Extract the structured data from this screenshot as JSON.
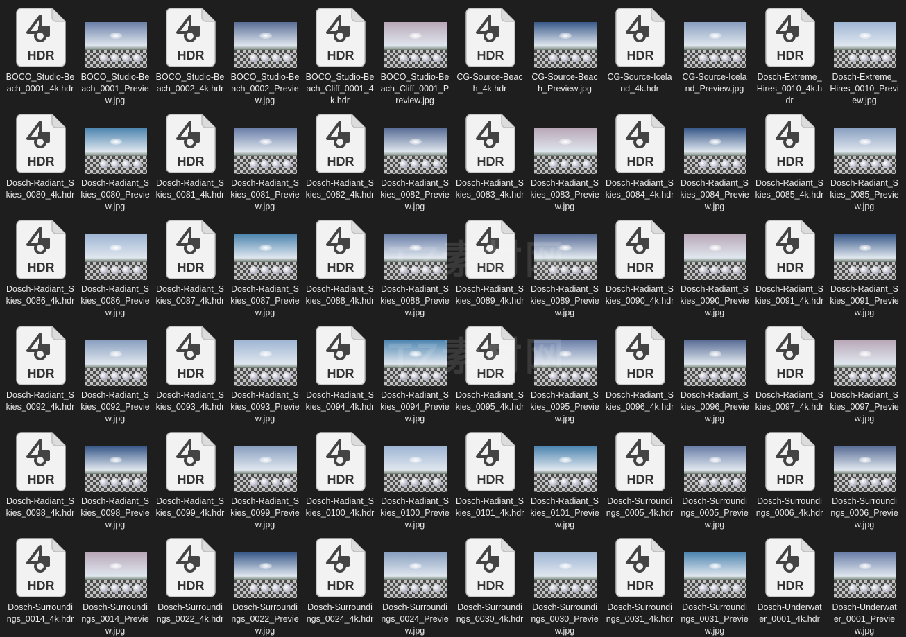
{
  "watermark": "TZ素材网",
  "icon_label": "HDR",
  "files": [
    "BOCO_Studio-Beach_0001_4k.hdr",
    "BOCO_Studio-Beach_0001_Preview.jpg",
    "BOCO_Studio-Beach_0002_4k.hdr",
    "BOCO_Studio-Beach_0002_Preview.jpg",
    "BOCO_Studio-Beach_Cliff_0001_4k.hdr",
    "BOCO_Studio-Beach_Cliff_0001_Preview.jpg",
    "CG-Source-Beach_4k.hdr",
    "CG-Source-Beach_Preview.jpg",
    "CG-Source-Iceland_4k.hdr",
    "CG-Source-Iceland_Preview.jpg",
    "Dosch-Extreme_Hires_0010_4k.hdr",
    "Dosch-Extreme_Hires_0010_Preview.jpg",
    "Dosch-Radiant_Skies_0080_4k.hdr",
    "Dosch-Radiant_Skies_0080_Preview.jpg",
    "Dosch-Radiant_Skies_0081_4k.hdr",
    "Dosch-Radiant_Skies_0081_Preview.jpg",
    "Dosch-Radiant_Skies_0082_4k.hdr",
    "Dosch-Radiant_Skies_0082_Preview.jpg",
    "Dosch-Radiant_Skies_0083_4k.hdr",
    "Dosch-Radiant_Skies_0083_Preview.jpg",
    "Dosch-Radiant_Skies_0084_4k.hdr",
    "Dosch-Radiant_Skies_0084_Preview.jpg",
    "Dosch-Radiant_Skies_0085_4k.hdr",
    "Dosch-Radiant_Skies_0085_Preview.jpg",
    "Dosch-Radiant_Skies_0086_4k.hdr",
    "Dosch-Radiant_Skies_0086_Preview.jpg",
    "Dosch-Radiant_Skies_0087_4k.hdr",
    "Dosch-Radiant_Skies_0087_Preview.jpg",
    "Dosch-Radiant_Skies_0088_4k.hdr",
    "Dosch-Radiant_Skies_0088_Preview.jpg",
    "Dosch-Radiant_Skies_0089_4k.hdr",
    "Dosch-Radiant_Skies_0089_Preview.jpg",
    "Dosch-Radiant_Skies_0090_4k.hdr",
    "Dosch-Radiant_Skies_0090_Preview.jpg",
    "Dosch-Radiant_Skies_0091_4k.hdr",
    "Dosch-Radiant_Skies_0091_Preview.jpg",
    "Dosch-Radiant_Skies_0092_4k.hdr",
    "Dosch-Radiant_Skies_0092_Preview.jpg",
    "Dosch-Radiant_Skies_0093_4k.hdr",
    "Dosch-Radiant_Skies_0093_Preview.jpg",
    "Dosch-Radiant_Skies_0094_4k.hdr",
    "Dosch-Radiant_Skies_0094_Preview.jpg",
    "Dosch-Radiant_Skies_0095_4k.hdr",
    "Dosch-Radiant_Skies_0095_Preview.jpg",
    "Dosch-Radiant_Skies_0096_4k.hdr",
    "Dosch-Radiant_Skies_0096_Preview.jpg",
    "Dosch-Radiant_Skies_0097_4k.hdr",
    "Dosch-Radiant_Skies_0097_Preview.jpg",
    "Dosch-Radiant_Skies_0098_4k.hdr",
    "Dosch-Radiant_Skies_0098_Preview.jpg",
    "Dosch-Radiant_Skies_0099_4k.hdr",
    "Dosch-Radiant_Skies_0099_Preview.jpg",
    "Dosch-Radiant_Skies_0100_4k.hdr",
    "Dosch-Radiant_Skies_0100_Preview.jpg",
    "Dosch-Radiant_Skies_0101_4k.hdr",
    "Dosch-Radiant_Skies_0101_Preview.jpg",
    "Dosch-Surroundings_0005_4k.hdr",
    "Dosch-Surroundings_0005_Preview.jpg",
    "Dosch-Surroundings_0006_4k.hdr",
    "Dosch-Surroundings_0006_Preview.jpg",
    "Dosch-Surroundings_0014_4k.hdr",
    "Dosch-Surroundings_0014_Preview.jpg",
    "Dosch-Surroundings_0022_4k.hdr",
    "Dosch-Surroundings_0022_Preview.jpg",
    "Dosch-Surroundings_0024_4k.hdr",
    "Dosch-Surroundings_0024_Preview.jpg",
    "Dosch-Surroundings_0030_4k.hdr",
    "Dosch-Surroundings_0030_Preview.jpg",
    "Dosch-Surroundings_0031_4k.hdr",
    "Dosch-Surroundings_0031_Preview.jpg",
    "Dosch-Underwater_0001_4k.hdr",
    "Dosch-Underwater_0001_Preview.jpg"
  ],
  "sky_colors": [
    "#3a5a8a",
    "#6b7fa8",
    "#8aa0c0",
    "#5a6e96",
    "#9fb6d4",
    "#b9a8b8",
    "#4e86b0"
  ]
}
